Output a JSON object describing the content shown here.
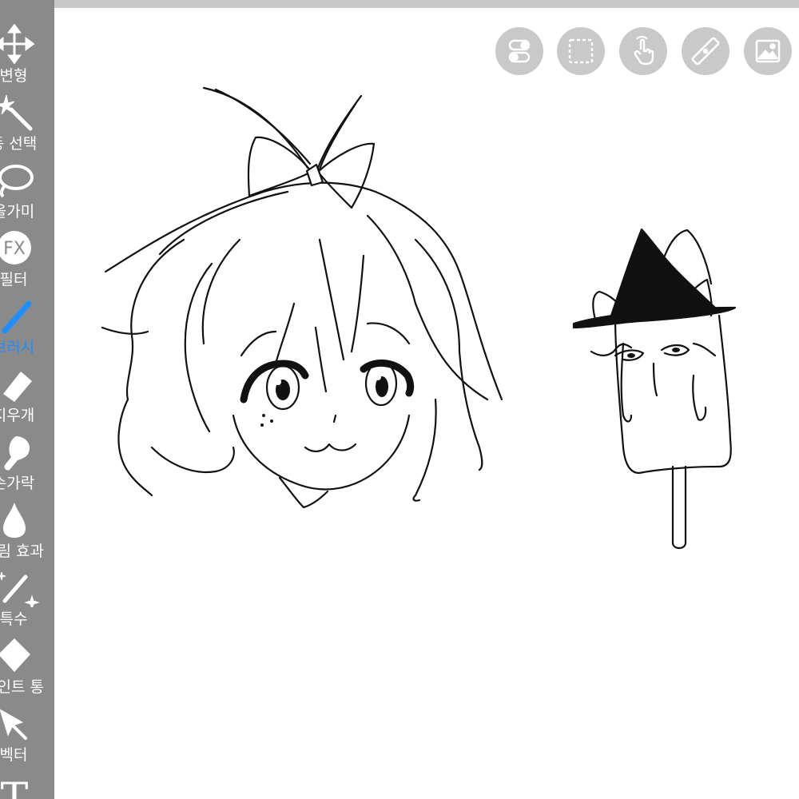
{
  "app": {
    "accent_color": "#1e8fff",
    "sidebar_color": "#8a8a8a"
  },
  "toolbar": {
    "tools": [
      {
        "label": "변형",
        "icon": "move-icon"
      },
      {
        "label": "동 선택",
        "icon": "magic-wand-icon"
      },
      {
        "label": "올가미",
        "icon": "lasso-icon"
      },
      {
        "label": "필터",
        "icon": "fx-icon",
        "glyph": "FX"
      },
      {
        "label": "브러시",
        "icon": "brush-icon",
        "active": true
      },
      {
        "label": "지우개",
        "icon": "eraser-icon"
      },
      {
        "label": "손가락",
        "icon": "smudge-finger-icon"
      },
      {
        "label": "흐림 효과",
        "icon": "blur-drop-icon"
      },
      {
        "label": "특수",
        "icon": "special-sparkle-icon"
      },
      {
        "label": "페인트 통",
        "icon": "paint-bucket-icon"
      },
      {
        "label": "벡터",
        "icon": "vector-cursor-icon"
      },
      {
        "label": "",
        "icon": "text-tool-icon",
        "glyph": "T"
      }
    ]
  },
  "quick_actions": [
    {
      "icon": "toggle-icon"
    },
    {
      "icon": "selection-icon"
    },
    {
      "icon": "touch-gesture-icon"
    },
    {
      "icon": "ruler-icon"
    },
    {
      "icon": "image-icon"
    }
  ]
}
